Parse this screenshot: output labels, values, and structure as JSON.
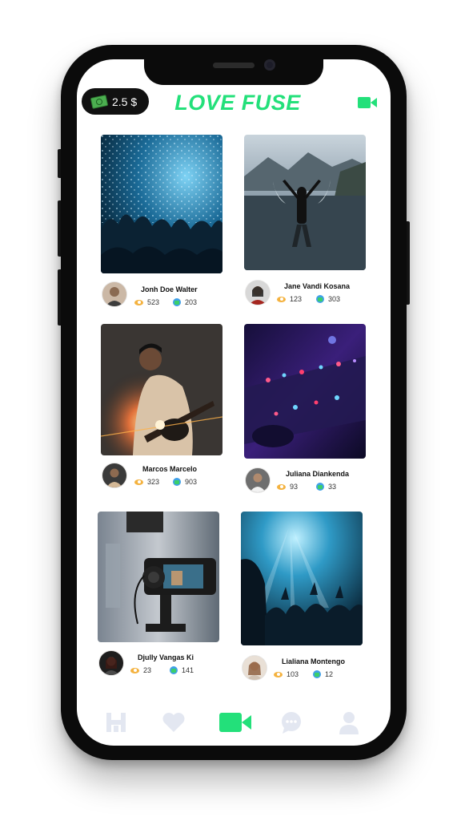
{
  "header": {
    "balance": "2.5 $",
    "logo": "LOVE FUSE"
  },
  "colors": {
    "accent": "#23e07a",
    "nav_inactive": "#e3e7f1",
    "views_icon": "#f4b23f",
    "gifts_icon": "#3fa0e8"
  },
  "streams": [
    {
      "name": "Jonh Doe Walter",
      "views": "523",
      "gifts": "203"
    },
    {
      "name": "Jane Vandi Kosana",
      "views": "123",
      "gifts": "303"
    },
    {
      "name": "Marcos Marcelo",
      "views": "323",
      "gifts": "903"
    },
    {
      "name": "Juliana Diankenda",
      "views": "93",
      "gifts": "33"
    },
    {
      "name": "Djully Vangas Ki",
      "views": "23",
      "gifts": "141"
    },
    {
      "name": "Lialiana Montengo",
      "views": "103",
      "gifts": "12"
    }
  ],
  "nav": {
    "items": [
      "home-icon",
      "heart-icon",
      "video-camera-icon",
      "chat-icon",
      "profile-icon"
    ],
    "active": "video-camera-icon"
  }
}
